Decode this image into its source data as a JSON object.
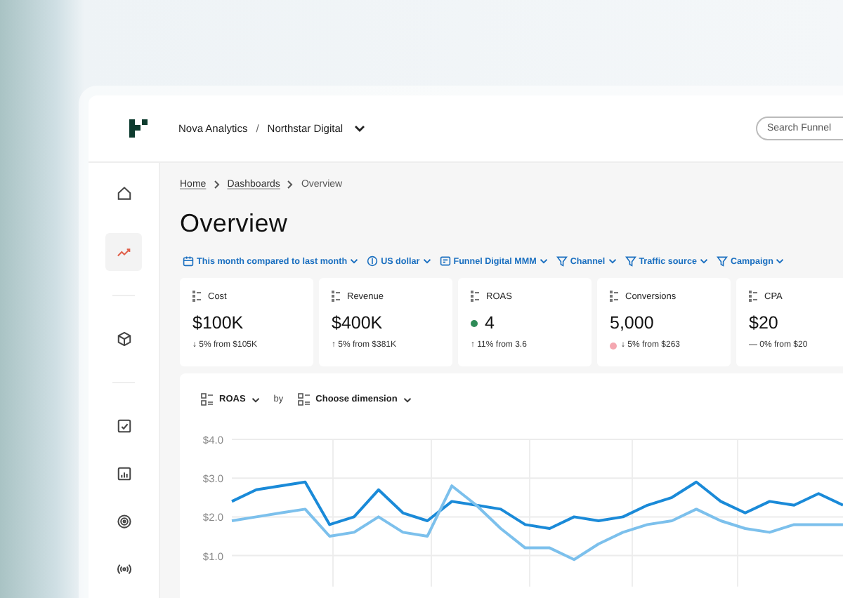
{
  "topbar": {
    "breadcrumb": [
      {
        "label": "Nova Analytics"
      },
      {
        "label": "Northstar Digital"
      }
    ],
    "separator": "/",
    "search": {
      "placeholder": "Search Funnel"
    }
  },
  "sidebar": {
    "items": [
      {
        "selected": false
      },
      {
        "selected": true
      },
      {
        "selected": false
      },
      {
        "selected": false
      },
      {
        "selected": false
      },
      {
        "selected": false
      },
      {
        "selected": false
      }
    ]
  },
  "breadcrumb": [
    {
      "label": "Home",
      "link": true
    },
    {
      "label": "Dashboards",
      "link": true
    },
    {
      "label": "Overview",
      "link": false
    }
  ],
  "title": "Overview",
  "filters": [
    {
      "label": "This month compared to last month"
    },
    {
      "label": "US dollar"
    },
    {
      "label": "Funnel Digital MMM"
    },
    {
      "label": "Channel"
    },
    {
      "label": "Traffic source"
    },
    {
      "label": "Campaign"
    }
  ],
  "metrics": [
    {
      "kind": "plain",
      "label": "Cost",
      "value": "$100K",
      "delta": "↓ 5% from $105K"
    },
    {
      "kind": "plain",
      "label": "Revenue",
      "value": "$400K",
      "delta": "↑ 5% from $381K"
    },
    {
      "kind": "value_dot",
      "label": "ROAS",
      "value": "4",
      "delta": "↑ 11% from 3.6",
      "color": "#2e8b57"
    },
    {
      "kind": "delta_dot",
      "label": "Conversions",
      "value": "5,000",
      "delta": "↓ 5% from $263",
      "color": "#f4a7b0"
    },
    {
      "kind": "plain",
      "label": "CPA",
      "value": "$20",
      "delta": "— 0% from $20"
    }
  ],
  "chart_panel": {
    "metric": "ROAS",
    "by": "by",
    "dimension": "Choose dimension",
    "chart_data": {
      "type": "line",
      "grid": true,
      "ylim": [
        0.2,
        4.0
      ],
      "yticks": [
        {
          "value": 1,
          "label": "$1.0"
        },
        {
          "value": 2,
          "label": "$2.0"
        },
        {
          "value": 3,
          "label": "$3.0"
        },
        {
          "value": 4,
          "label": "$4.0"
        }
      ],
      "series": [
        {
          "color": "#1a8ad8",
          "values": [
            2.4,
            2.7,
            2.8,
            2.9,
            1.8,
            2.0,
            2.7,
            2.1,
            1.9,
            2.4,
            2.3,
            2.2,
            1.8,
            1.7,
            2.0,
            1.9,
            2.0,
            2.3,
            2.5,
            2.9,
            2.4,
            2.1,
            2.4,
            2.3,
            2.6,
            2.3
          ]
        },
        {
          "color": "#7cc0ec",
          "values": [
            1.9,
            2.0,
            2.1,
            2.2,
            1.5,
            1.6,
            2.0,
            1.6,
            1.5,
            2.8,
            2.3,
            1.7,
            1.2,
            1.2,
            0.9,
            1.3,
            1.6,
            1.8,
            1.9,
            2.2,
            1.9,
            1.7,
            1.6,
            1.8,
            1.8,
            1.8
          ]
        }
      ]
    }
  }
}
